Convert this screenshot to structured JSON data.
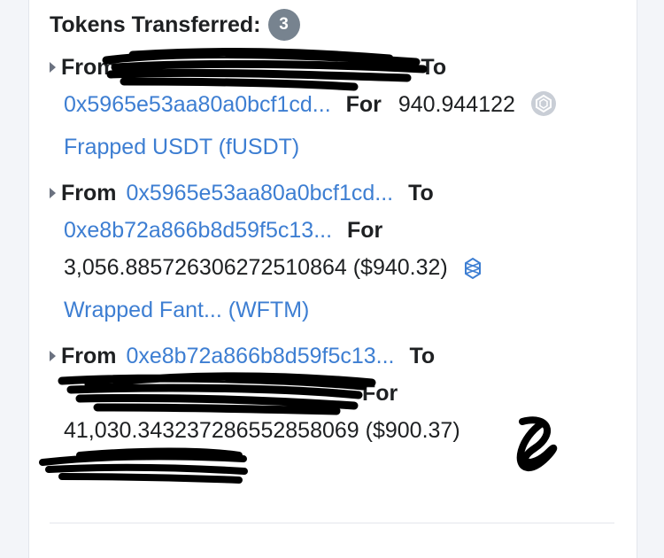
{
  "section": {
    "title": "Tokens Transferred:",
    "count": "3"
  },
  "transfers": [
    {
      "from_label": "From",
      "from": "0x…",
      "to_label": "To",
      "to": "0x5965e53aa80a0bcf1cd...",
      "for_label": "For",
      "amount": "940.944122",
      "token_icon": "token-placeholder-icon",
      "token": "Frapped USDT (fUSDT)"
    },
    {
      "from_label": "From",
      "from": "0x5965e53aa80a0bcf1cd...",
      "to_label": "To",
      "to": "0xe8b72a866b8d59f5c13...",
      "for_label": "For",
      "amount": "3,056.885726306272510864 ($940.32)",
      "token_icon": "fantom-icon",
      "token": "Wrapped Fant... (WFTM)"
    },
    {
      "from_label": "From",
      "from": "0xe8b72a866b8d59f5c13...",
      "to_label": "To",
      "to": "0x…",
      "for_label": "For",
      "amount": "41,030.343237286552858069 ($900.37)",
      "token_icon": "token-icon",
      "token": ""
    }
  ],
  "colors": {
    "link": "#3d7ed2",
    "text": "#1e2022",
    "badge": "#77838f",
    "scribble": "#000000"
  }
}
